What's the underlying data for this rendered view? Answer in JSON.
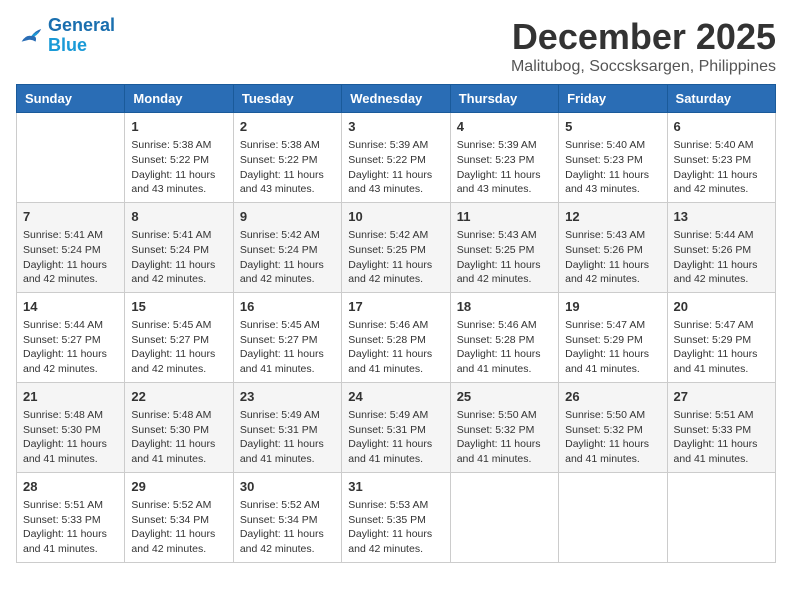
{
  "logo": {
    "line1": "General",
    "line2": "Blue"
  },
  "title": "December 2025",
  "subtitle": "Malitubog, Soccsksargen, Philippines",
  "weekdays": [
    "Sunday",
    "Monday",
    "Tuesday",
    "Wednesday",
    "Thursday",
    "Friday",
    "Saturday"
  ],
  "weeks": [
    [
      {
        "day": "",
        "info": ""
      },
      {
        "day": "1",
        "info": "Sunrise: 5:38 AM\nSunset: 5:22 PM\nDaylight: 11 hours\nand 43 minutes."
      },
      {
        "day": "2",
        "info": "Sunrise: 5:38 AM\nSunset: 5:22 PM\nDaylight: 11 hours\nand 43 minutes."
      },
      {
        "day": "3",
        "info": "Sunrise: 5:39 AM\nSunset: 5:22 PM\nDaylight: 11 hours\nand 43 minutes."
      },
      {
        "day": "4",
        "info": "Sunrise: 5:39 AM\nSunset: 5:23 PM\nDaylight: 11 hours\nand 43 minutes."
      },
      {
        "day": "5",
        "info": "Sunrise: 5:40 AM\nSunset: 5:23 PM\nDaylight: 11 hours\nand 43 minutes."
      },
      {
        "day": "6",
        "info": "Sunrise: 5:40 AM\nSunset: 5:23 PM\nDaylight: 11 hours\nand 42 minutes."
      }
    ],
    [
      {
        "day": "7",
        "info": "Sunrise: 5:41 AM\nSunset: 5:24 PM\nDaylight: 11 hours\nand 42 minutes."
      },
      {
        "day": "8",
        "info": "Sunrise: 5:41 AM\nSunset: 5:24 PM\nDaylight: 11 hours\nand 42 minutes."
      },
      {
        "day": "9",
        "info": "Sunrise: 5:42 AM\nSunset: 5:24 PM\nDaylight: 11 hours\nand 42 minutes."
      },
      {
        "day": "10",
        "info": "Sunrise: 5:42 AM\nSunset: 5:25 PM\nDaylight: 11 hours\nand 42 minutes."
      },
      {
        "day": "11",
        "info": "Sunrise: 5:43 AM\nSunset: 5:25 PM\nDaylight: 11 hours\nand 42 minutes."
      },
      {
        "day": "12",
        "info": "Sunrise: 5:43 AM\nSunset: 5:26 PM\nDaylight: 11 hours\nand 42 minutes."
      },
      {
        "day": "13",
        "info": "Sunrise: 5:44 AM\nSunset: 5:26 PM\nDaylight: 11 hours\nand 42 minutes."
      }
    ],
    [
      {
        "day": "14",
        "info": "Sunrise: 5:44 AM\nSunset: 5:27 PM\nDaylight: 11 hours\nand 42 minutes."
      },
      {
        "day": "15",
        "info": "Sunrise: 5:45 AM\nSunset: 5:27 PM\nDaylight: 11 hours\nand 42 minutes."
      },
      {
        "day": "16",
        "info": "Sunrise: 5:45 AM\nSunset: 5:27 PM\nDaylight: 11 hours\nand 41 minutes."
      },
      {
        "day": "17",
        "info": "Sunrise: 5:46 AM\nSunset: 5:28 PM\nDaylight: 11 hours\nand 41 minutes."
      },
      {
        "day": "18",
        "info": "Sunrise: 5:46 AM\nSunset: 5:28 PM\nDaylight: 11 hours\nand 41 minutes."
      },
      {
        "day": "19",
        "info": "Sunrise: 5:47 AM\nSunset: 5:29 PM\nDaylight: 11 hours\nand 41 minutes."
      },
      {
        "day": "20",
        "info": "Sunrise: 5:47 AM\nSunset: 5:29 PM\nDaylight: 11 hours\nand 41 minutes."
      }
    ],
    [
      {
        "day": "21",
        "info": "Sunrise: 5:48 AM\nSunset: 5:30 PM\nDaylight: 11 hours\nand 41 minutes."
      },
      {
        "day": "22",
        "info": "Sunrise: 5:48 AM\nSunset: 5:30 PM\nDaylight: 11 hours\nand 41 minutes."
      },
      {
        "day": "23",
        "info": "Sunrise: 5:49 AM\nSunset: 5:31 PM\nDaylight: 11 hours\nand 41 minutes."
      },
      {
        "day": "24",
        "info": "Sunrise: 5:49 AM\nSunset: 5:31 PM\nDaylight: 11 hours\nand 41 minutes."
      },
      {
        "day": "25",
        "info": "Sunrise: 5:50 AM\nSunset: 5:32 PM\nDaylight: 11 hours\nand 41 minutes."
      },
      {
        "day": "26",
        "info": "Sunrise: 5:50 AM\nSunset: 5:32 PM\nDaylight: 11 hours\nand 41 minutes."
      },
      {
        "day": "27",
        "info": "Sunrise: 5:51 AM\nSunset: 5:33 PM\nDaylight: 11 hours\nand 41 minutes."
      }
    ],
    [
      {
        "day": "28",
        "info": "Sunrise: 5:51 AM\nSunset: 5:33 PM\nDaylight: 11 hours\nand 41 minutes."
      },
      {
        "day": "29",
        "info": "Sunrise: 5:52 AM\nSunset: 5:34 PM\nDaylight: 11 hours\nand 42 minutes."
      },
      {
        "day": "30",
        "info": "Sunrise: 5:52 AM\nSunset: 5:34 PM\nDaylight: 11 hours\nand 42 minutes."
      },
      {
        "day": "31",
        "info": "Sunrise: 5:53 AM\nSunset: 5:35 PM\nDaylight: 11 hours\nand 42 minutes."
      },
      {
        "day": "",
        "info": ""
      },
      {
        "day": "",
        "info": ""
      },
      {
        "day": "",
        "info": ""
      }
    ]
  ]
}
